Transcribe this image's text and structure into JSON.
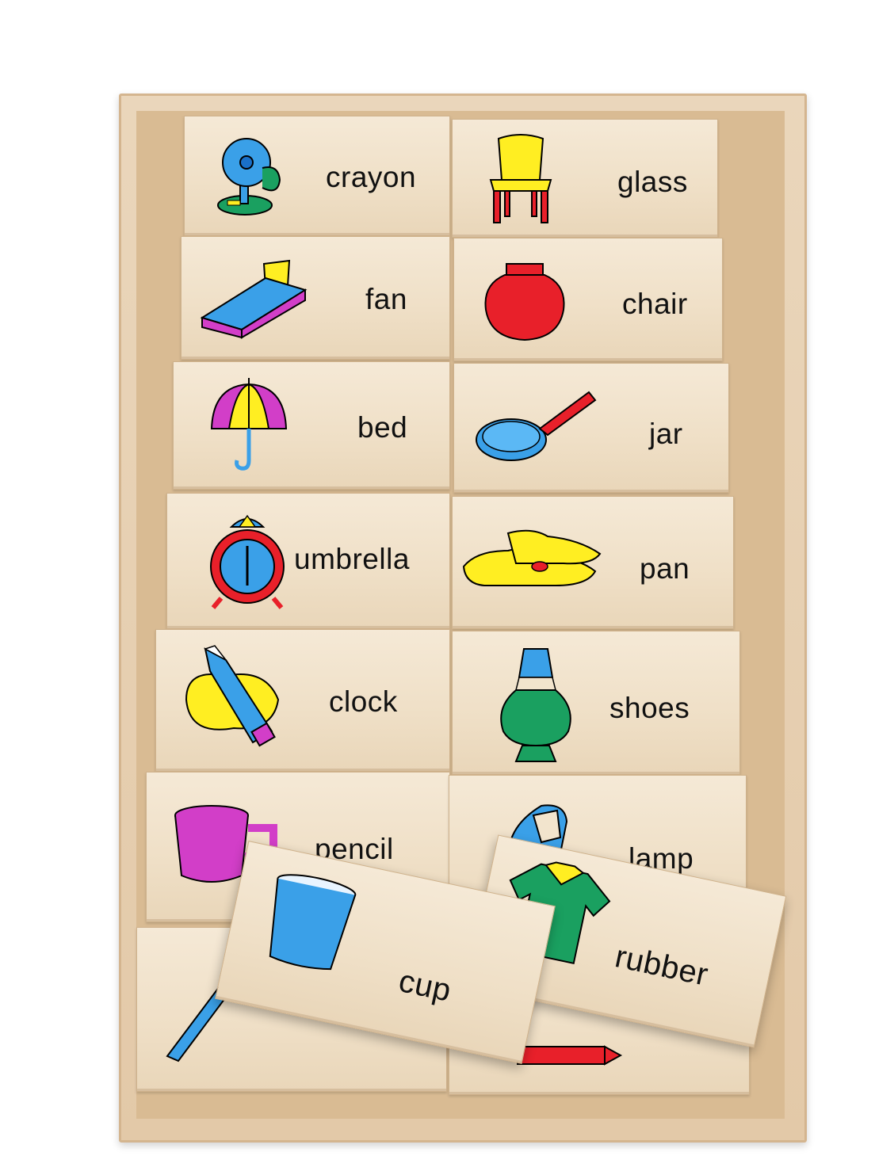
{
  "tiles": {
    "crayon": "crayon",
    "glass": "glass",
    "fan": "fan",
    "chair": "chair",
    "bed": "bed",
    "jar": "jar",
    "umbrella": "umbrella",
    "pan": "pan",
    "clock": "clock",
    "shoes": "shoes",
    "pencil": "pencil",
    "lamp": "lamp",
    "cup": "cup",
    "rubber": "rubber"
  },
  "icons": {
    "r1_left": "fan-icon",
    "r1_right": "chair-icon",
    "r2_left": "bed-icon",
    "r2_right": "jar-icon",
    "r3_left": "umbrella-icon",
    "r3_right": "pan-icon",
    "r4_left": "clock-icon",
    "r4_right": "shoes-icon",
    "r5_left": "pencil-icon",
    "r5_right": "lamp-icon",
    "r6_left": "cup-icon",
    "r6_right": "iron-icon",
    "loose_left": "glass-icon",
    "loose_right": "shirt-icon"
  },
  "colors": {
    "wood_light": "#f2e4cd",
    "tray": "#e3c9a8",
    "blue": "#3aa0e8",
    "yellow": "#ffee22",
    "red": "#e8202a",
    "magenta": "#d23ec8",
    "green": "#1aa060"
  }
}
